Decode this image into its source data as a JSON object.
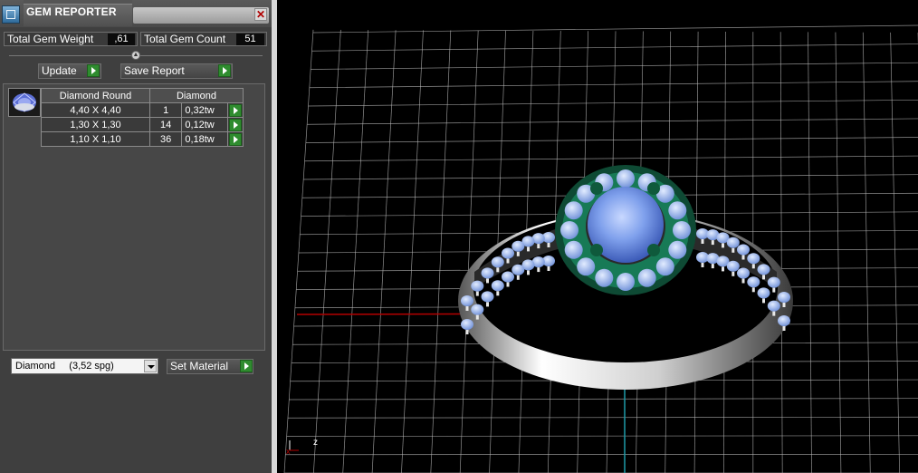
{
  "window": {
    "title": "GEM REPORTER",
    "close_glyph": "✕"
  },
  "stats": {
    "total_weight_label": "Total Gem Weight",
    "total_weight_value": ",61",
    "total_count_label": "Total Gem Count",
    "total_count_value": "51"
  },
  "toolbar": {
    "update_label": "Update",
    "save_report_label": "Save Report"
  },
  "gem_table": {
    "headers": [
      "Diamond Round",
      "Diamond"
    ],
    "rows": [
      {
        "size": "4,40 X 4,40",
        "count": "1",
        "weight": "0,32tw"
      },
      {
        "size": "1,30 X 1,30",
        "count": "14",
        "weight": "0,12tw"
      },
      {
        "size": "1,10 X 1,10",
        "count": "36",
        "weight": "0,18tw"
      }
    ]
  },
  "material": {
    "selected": "Diamond     (3,52 spg)",
    "set_material_label": "Set Material"
  },
  "viewport": {
    "axis_labels": {
      "z": "z",
      "x": "x"
    },
    "colors": {
      "grid": "#bfbfbf",
      "x_axis": "#b40000",
      "z_axis": "#1e9aa8",
      "gem": "#7fa6e8",
      "prong": "#0f5a3c"
    }
  }
}
